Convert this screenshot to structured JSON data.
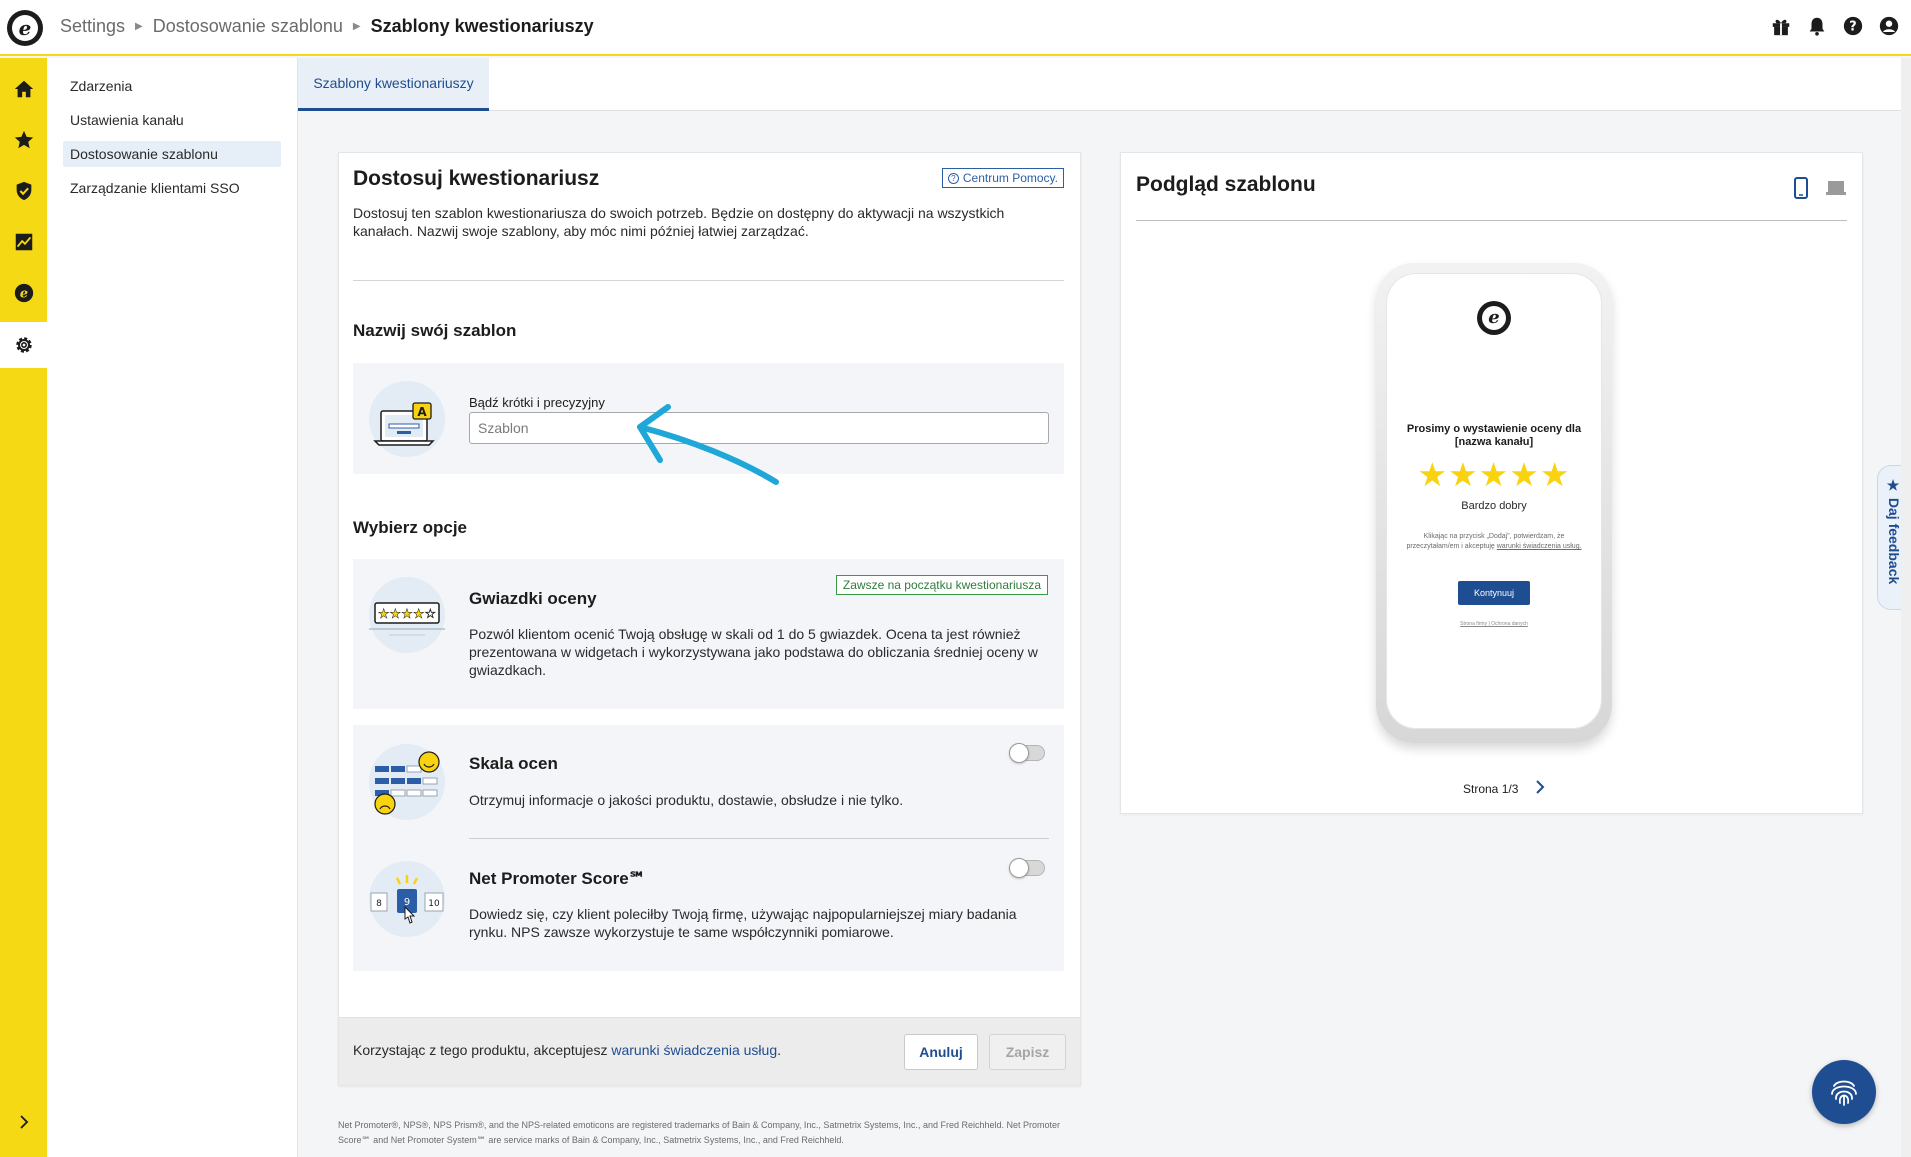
{
  "breadcrumb": {
    "items": [
      "Settings",
      "Dostosowanie szablonu"
    ],
    "current": "Szablony kwestionariuszy"
  },
  "top_icons": [
    "gift-icon",
    "bell-icon",
    "help-icon",
    "user-icon"
  ],
  "rail": {
    "items": [
      "home-icon",
      "star-icon",
      "shield-icon",
      "analytics-icon",
      "trustpilot-icon",
      "settings-icon"
    ],
    "active": "settings-icon",
    "expand": "chevron-right-icon"
  },
  "subnav": {
    "items": [
      {
        "label": "Zdarzenia"
      },
      {
        "label": "Ustawienia kanału"
      },
      {
        "label": "Dostosowanie szablonu",
        "active": true
      },
      {
        "label": "Zarządzanie klientami SSO"
      }
    ]
  },
  "tabs": [
    {
      "label": "Szablony kwestionariuszy",
      "active": true
    }
  ],
  "customize": {
    "title": "Dostosuj kwestionariusz",
    "help_label": "Centrum Pomocy.",
    "description": "Dostosuj ten szablon kwestionariusza do swoich potrzeb. Będzie on dostępny do aktywacji na wszystkich kanałach. Nazwij swoje szablony, aby móc nimi później łatwiej zarządzać.",
    "name_section": {
      "title": "Nazwij swój szablon",
      "field_label": "Bądź krótki i precyzyjny",
      "field_value": "",
      "field_placeholder": "Szablon"
    },
    "options_section": {
      "title": "Wybierz opcje",
      "stars": {
        "title": "Gwiazdki oceny",
        "badge": "Zawsze na początku kwestionariusza",
        "description": "Pozwól klientom ocenić Twoją obsługę w skali od 1 do 5 gwiazdek. Ocena ta jest również prezentowana w widgetach i wykorzystywana jako podstawa do obliczania średniej oceny w gwiazdkach."
      },
      "scale": {
        "title": "Skala ocen",
        "description": "Otrzymuj informacje o jakości produktu, dostawie, obsłudze i nie tylko.",
        "enabled": false
      },
      "nps": {
        "title": "Net Promoter Score℠",
        "description": "Dowiedz się, czy klient poleciłby Twoją firmę, używając najpopularniejszej miary badania rynku. NPS zawsze wykorzystuje te same współczynniki pomiarowe.",
        "enabled": false,
        "illustration_numbers": [
          "8",
          "9",
          "10"
        ]
      }
    },
    "footer": {
      "terms_prefix": "Korzystając z tego produktu, akceptujesz ",
      "terms_link": "warunki świadczenia usług",
      "terms_suffix": ".",
      "cancel_label": "Anuluj",
      "save_label": "Zapisz"
    }
  },
  "preview": {
    "title": "Podgląd szablonu",
    "devices": [
      "mobile-icon",
      "laptop-icon"
    ],
    "active_device": "mobile",
    "phone": {
      "question": "Prosimy o wystawienie oceny dla [nazwa kanału]",
      "stars": "★★★★★",
      "rating_label": "Bardzo dobry",
      "consent_prefix": "Klikając na przycisk „Dodaj”, potwierdzam, że przeczytałam/em i akceptuję ",
      "consent_link": "warunki świadczenia usług.",
      "button_label": "Kontynuuj",
      "footer_links": "Strona firmy | Ochrona danych"
    },
    "pager": {
      "label": "Strona 1/3"
    }
  },
  "feedback": {
    "label": "Daj feedback",
    "icon": "star-icon"
  },
  "legal": "Net Promoter®, NPS®, NPS Prism®, and the NPS-related emoticons are registered trademarks of Bain & Company, Inc., Satmetrix Systems, Inc., and Fred Reichheld. Net Promoter Score℠ and Net Promoter System℠ are service marks of Bain & Company, Inc., Satmetrix Systems, Inc., and Fred Reichheld.",
  "colors": {
    "brand_yellow": "#f5d915",
    "accent_blue": "#1f4d92",
    "arrow_cyan": "#1fa7d8",
    "badge_green": "#3a9c4a",
    "star_yellow": "#f9d30f"
  }
}
